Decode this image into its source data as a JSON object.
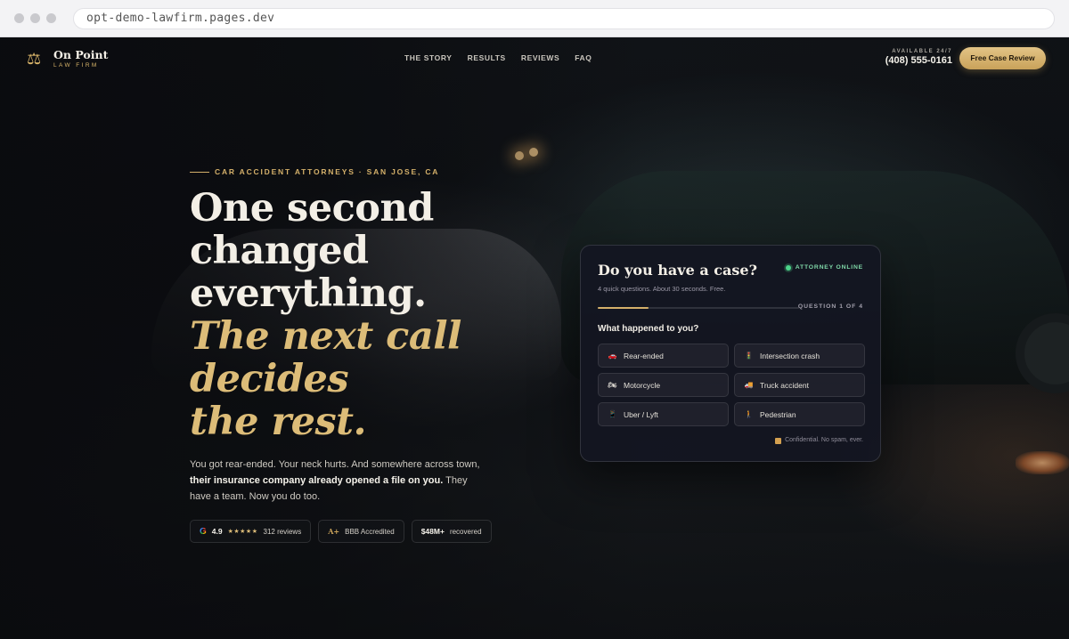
{
  "browser": {
    "url": "opt-demo-lawfirm.pages.dev"
  },
  "header": {
    "logo_name": "On Point",
    "logo_sub": "LAW FIRM",
    "nav": [
      "THE STORY",
      "RESULTS",
      "REVIEWS",
      "FAQ"
    ],
    "availability": "AVAILABLE 24/7",
    "phone": "(408) 555-0161",
    "cta_label": "Free Case Review"
  },
  "hero": {
    "eyebrow": "CAR ACCIDENT ATTORNEYS · SAN JOSE, CA",
    "headline_lines": [
      "One second",
      "changed",
      "everything."
    ],
    "headline_gold_lines": [
      "The next call",
      "decides",
      "the rest."
    ],
    "body_pre": "You got rear-ended. Your neck hurts. And somewhere across town,",
    "body_bold": "their insurance company already opened a file on you.",
    "body_post": "They have a team. Now you do too.",
    "badges": {
      "google_letter": "G",
      "rating": "4.9",
      "stars": "★★★★★",
      "reviews": "312 reviews",
      "bbb": "BBB Accredited",
      "bbb_mark": "A+",
      "recovered_amount": "$48M+",
      "recovered_label": "recovered"
    }
  },
  "case_card": {
    "title": "Do you have a case?",
    "subtitle": "4 quick questions. About 30 seconds. Free.",
    "status": "ATTORNEY ONLINE",
    "progress": 0.25,
    "question_count": "QUESTION 1 OF 4",
    "question": "What happened to you?",
    "options": [
      {
        "label": "Rear-ended",
        "icon": "car-icon",
        "glyph": "🚗"
      },
      {
        "label": "Intersection crash",
        "icon": "traffic-light-icon",
        "glyph": "🚦"
      },
      {
        "label": "Motorcycle",
        "icon": "motorcycle-icon",
        "glyph": "🏍"
      },
      {
        "label": "Truck accident",
        "icon": "truck-icon",
        "glyph": "🚚"
      },
      {
        "label": "Uber / Lyft",
        "icon": "phone-icon",
        "glyph": "📱"
      },
      {
        "label": "Pedestrian",
        "icon": "pedestrian-icon",
        "glyph": "🚶"
      }
    ],
    "confidential": "Confidential. No spam, ever."
  },
  "colors": {
    "gold": "#d4b06a",
    "online_green": "#4cd48a",
    "card_bg": "#141622"
  }
}
